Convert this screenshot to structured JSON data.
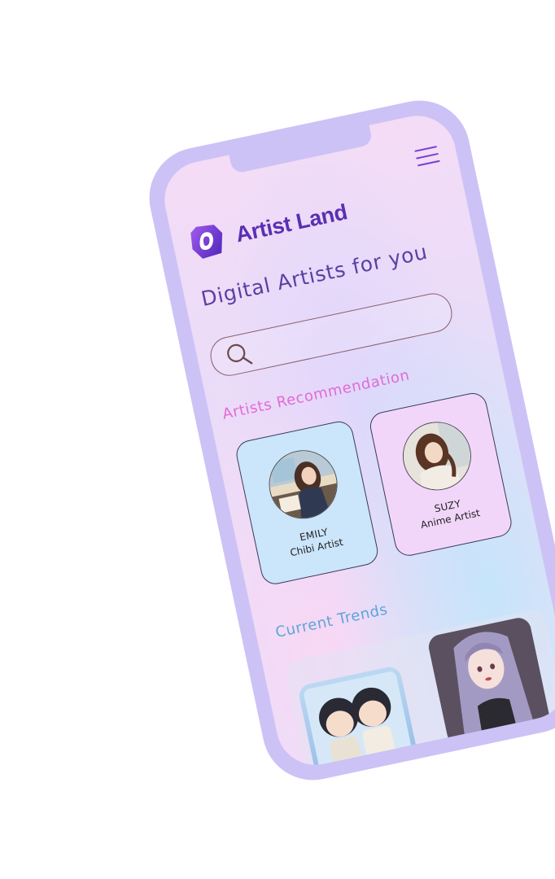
{
  "brand": {
    "name": "Artist Land"
  },
  "header": {
    "headline": "Digital Artists for you"
  },
  "search": {
    "placeholder": ""
  },
  "sections": {
    "recommendation": "Artists Recommendation",
    "trends": "Current Trends"
  },
  "artists": [
    {
      "name": "EMILY",
      "role": "Chibi Artist"
    },
    {
      "name": "SUZY",
      "role": "Anime Artist"
    }
  ],
  "colors": {
    "frame": "#cdc2f6",
    "brand": "#5a2fb2",
    "recommendation_heading": "#e26bd4",
    "trends_heading": "#5aa6d8",
    "card_emily": "#cbe5fb",
    "card_suzy": "#f2d6fa"
  },
  "icons": {
    "menu": "hamburger-menu-icon",
    "search": "search-icon",
    "logo": "artist-land-logo"
  }
}
